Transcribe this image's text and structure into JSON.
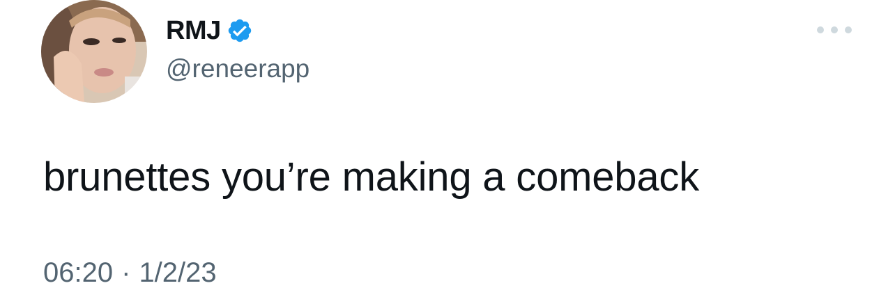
{
  "author": {
    "display_name": "RMJ",
    "handle": "@reneerapp",
    "verified": true,
    "avatar_icon": "profile-photo"
  },
  "tweet": {
    "text": "brunettes you’re making a comeback",
    "time": "06:20",
    "separator": "·",
    "date": "1/2/23"
  },
  "menu": {
    "more_icon": "more-horizontal-icon"
  },
  "colors": {
    "verified_blue": "#1d9bf0",
    "text_primary": "#0f1419",
    "text_secondary": "#536471",
    "more_dots": "#cfd9de"
  }
}
